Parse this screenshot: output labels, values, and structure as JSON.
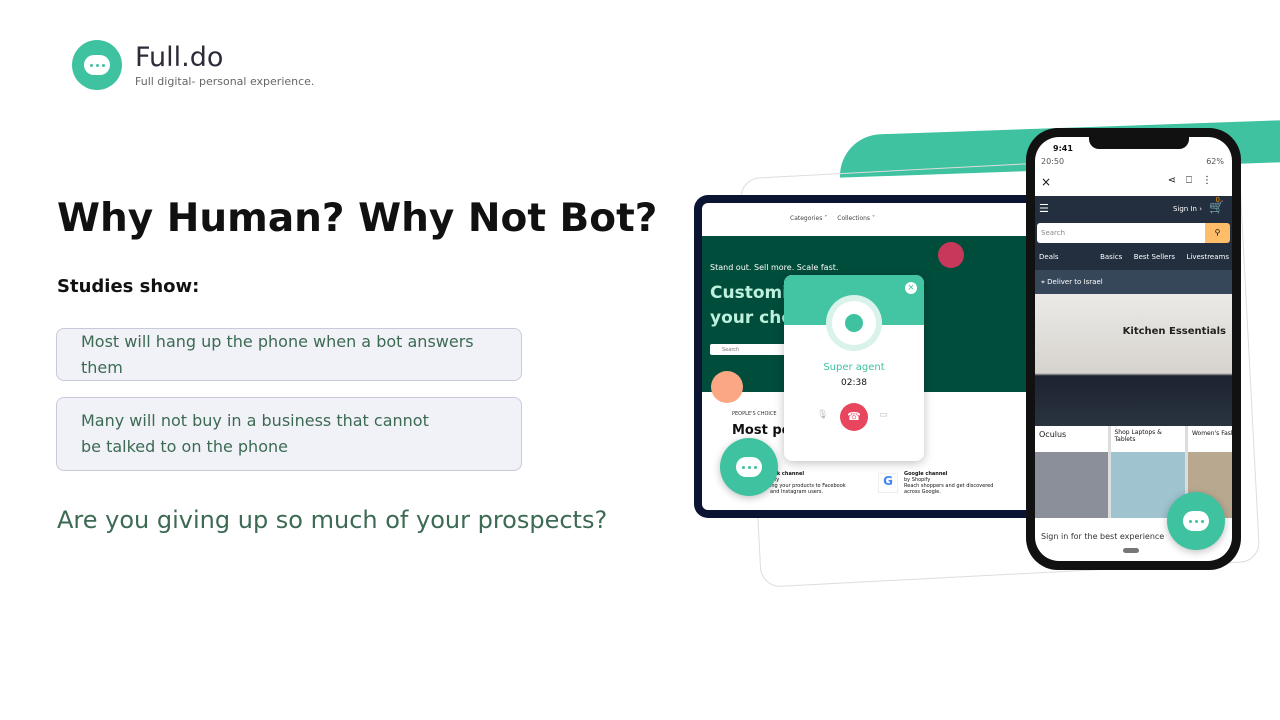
{
  "brand": {
    "name": "Full.do",
    "tagline": "Full digital- personal experience."
  },
  "heading": "Why Human? Why Not Bot?",
  "studies_label": "Studies show:",
  "facts": [
    "Most will hang up the phone when a bot answers them",
    "Many will not buy in a business that cannot be talked to on the phone"
  ],
  "question": "Are you giving up so much of your prospects?",
  "tablet": {
    "nav": [
      "Categories ˅",
      "Collections ˅"
    ],
    "hero_small": "Stand out. Sell more. Scale fast.",
    "hero_big1": "Customiz",
    "hero_big2": "your choi",
    "search": "Search",
    "peoples_choice": "PEOPLE'S CHOICE",
    "most_pop": "Most pop",
    "fb_title": "ook channel",
    "fb_by": "pify",
    "fb_desc": "ing your products to Facebook and Instagram users.",
    "g_title": "Google channel",
    "g_by": "by Shopify",
    "g_desc": "Reach shoppers and get discovered across Google."
  },
  "call": {
    "agent": "Super agent",
    "timer": "02:38"
  },
  "phone": {
    "time": "9:41",
    "time2": "20:50",
    "battery": "62%",
    "sign_in": "Sign In ›",
    "cart_count": "0",
    "search": "Search",
    "nav": [
      "Deals",
      "Basics",
      "Best Sellers",
      "Livestreams"
    ],
    "deliver": "Deliver to Israel",
    "banner": "Kitchen Essentials",
    "tiles": [
      "Oculus",
      "Shop Laptops & Tablets",
      "Women's Fash"
    ],
    "signin_banner": "Sign in for the best experience"
  },
  "colors": {
    "accent": "#3fc2a0",
    "text_green": "#3c6a52",
    "hero": "#014d3c",
    "hangup": "#e8465e"
  }
}
